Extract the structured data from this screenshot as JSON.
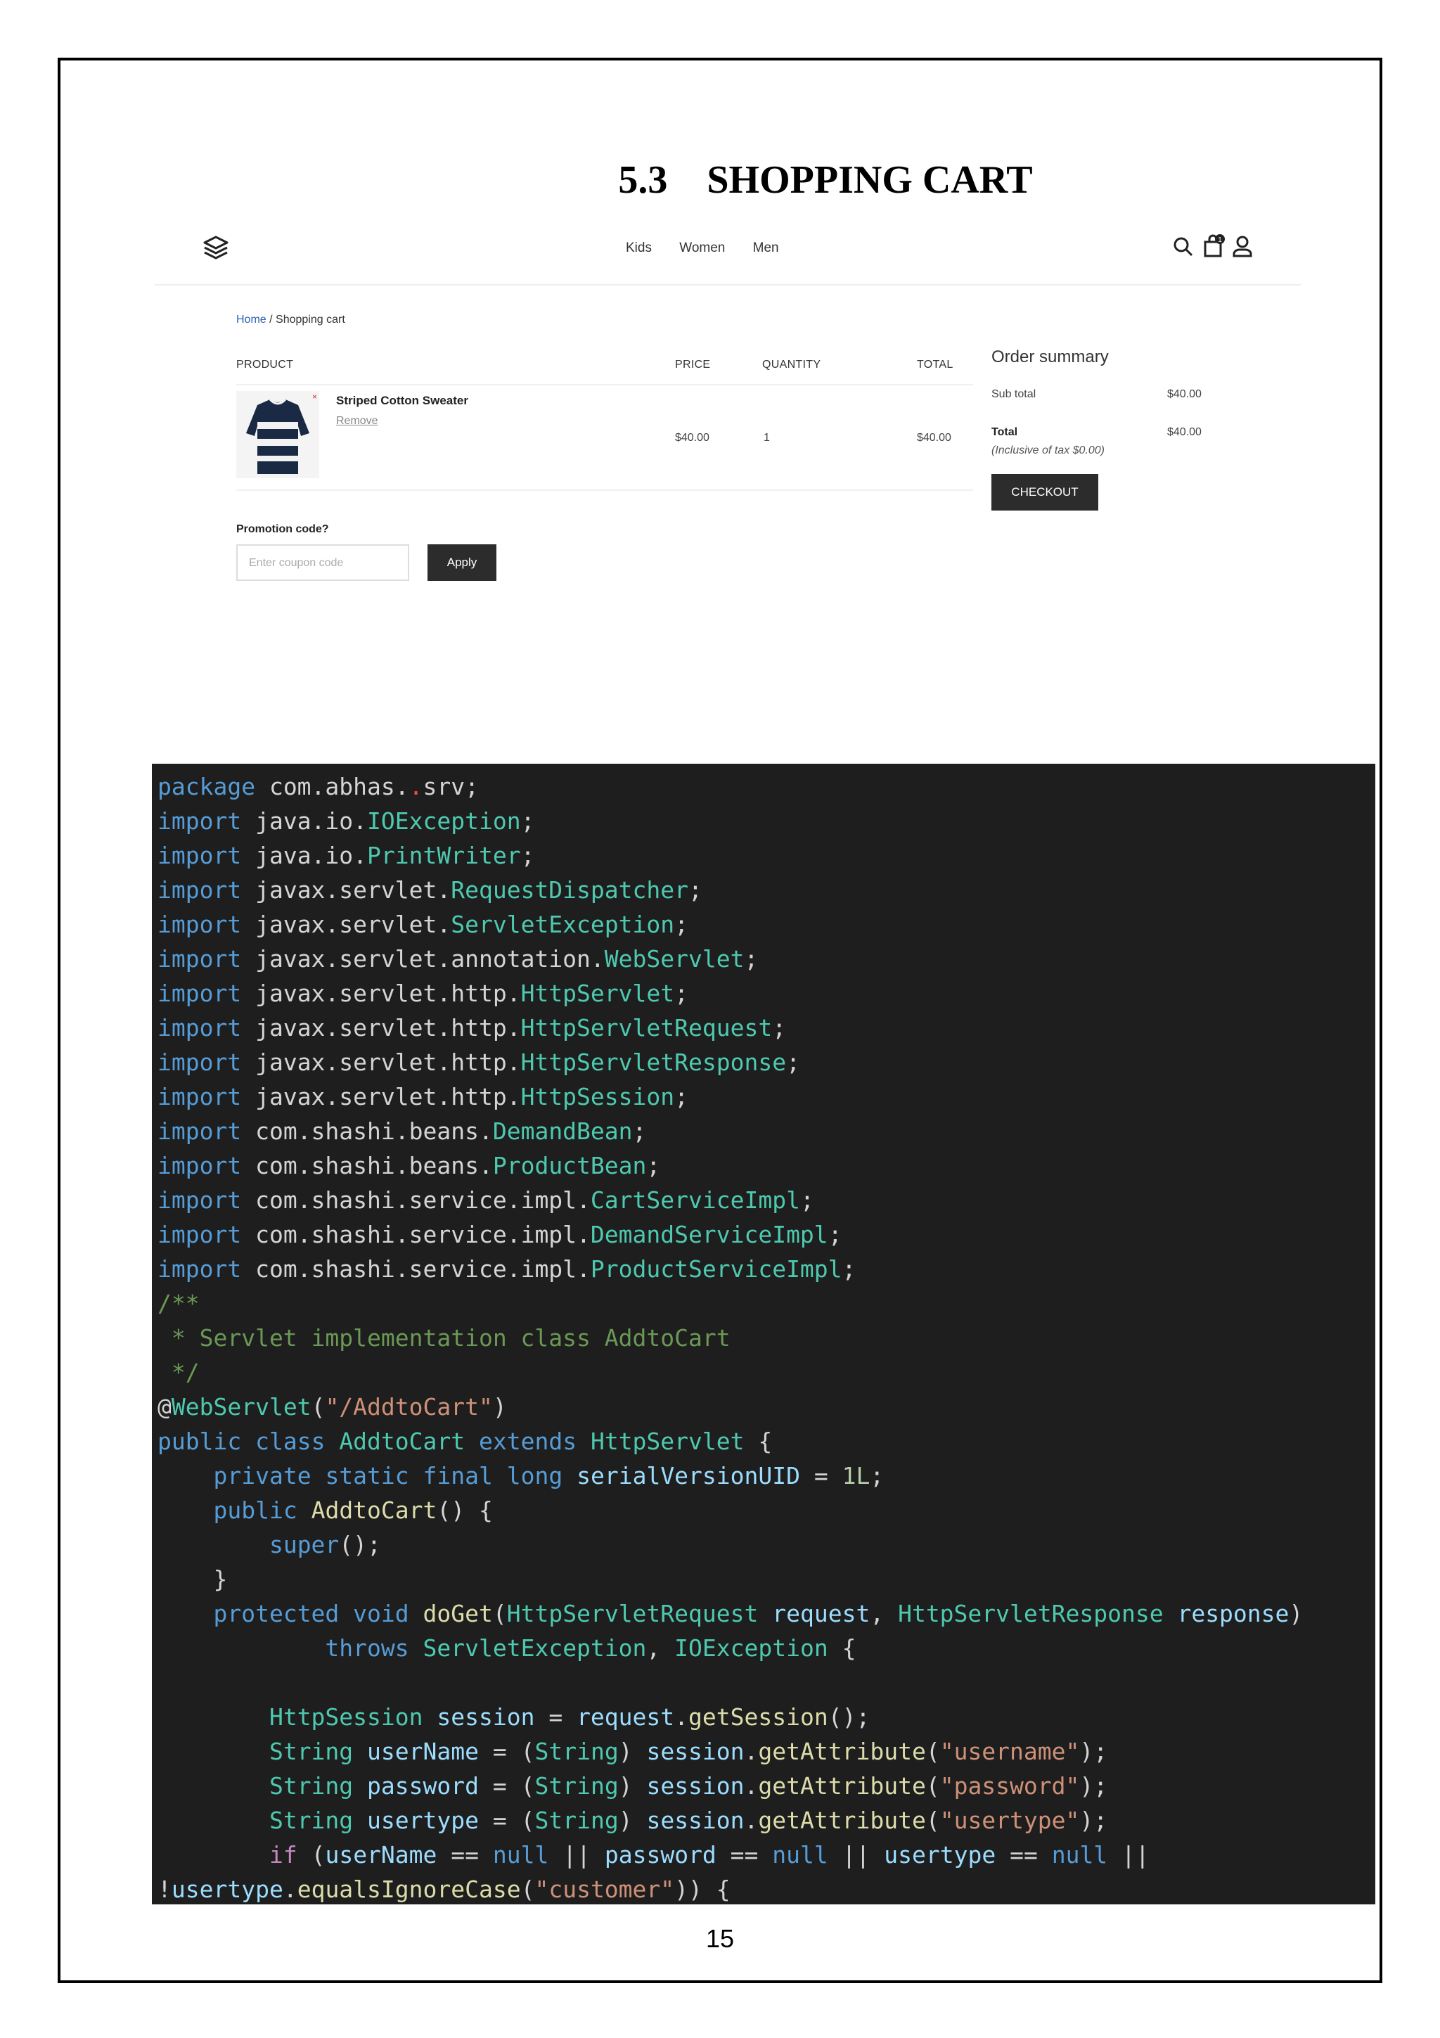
{
  "document": {
    "section_number": "5.3",
    "section_title": "SHOPPING CART",
    "page_number": "15"
  },
  "screenshot": {
    "nav": {
      "links": [
        "Kids",
        "Women",
        "Men"
      ],
      "cart_count": "1"
    },
    "breadcrumb": {
      "home": "Home",
      "separator": "/",
      "current": "Shopping cart"
    },
    "table_headers": {
      "product": "PRODUCT",
      "price": "PRICE",
      "quantity": "QUANTITY",
      "total": "TOTAL"
    },
    "item": {
      "name": "Striped Cotton Sweater",
      "remove": "Remove",
      "price": "$40.00",
      "quantity": "1",
      "total": "$40.00"
    },
    "promo": {
      "label": "Promotion code?",
      "placeholder": "Enter coupon code",
      "apply": "Apply"
    },
    "summary": {
      "title": "Order summary",
      "subtotal_label": "Sub total",
      "subtotal_value": "$40.00",
      "total_label": "Total",
      "total_value": "$40.00",
      "tax_note": "(Inclusive of tax $0.00)",
      "checkout": "CHECKOUT"
    }
  },
  "code_lines": [
    [
      [
        "kw",
        "package"
      ],
      [
        "p",
        " com.abhas."
      ],
      [
        "err",
        "."
      ],
      [
        "p",
        "srv;"
      ]
    ],
    [
      [
        "kw",
        "import"
      ],
      [
        "p",
        " java.io."
      ],
      [
        "ty",
        "IOException"
      ],
      [
        "p",
        ";"
      ]
    ],
    [
      [
        "kw",
        "import"
      ],
      [
        "p",
        " java.io."
      ],
      [
        "ty",
        "PrintWriter"
      ],
      [
        "p",
        ";"
      ]
    ],
    [
      [
        "kw",
        "import"
      ],
      [
        "p",
        " javax.servlet."
      ],
      [
        "ty",
        "RequestDispatcher"
      ],
      [
        "p",
        ";"
      ]
    ],
    [
      [
        "kw",
        "import"
      ],
      [
        "p",
        " javax.servlet."
      ],
      [
        "ty",
        "ServletException"
      ],
      [
        "p",
        ";"
      ]
    ],
    [
      [
        "kw",
        "import"
      ],
      [
        "p",
        " javax.servlet.annotation."
      ],
      [
        "ty",
        "WebServlet"
      ],
      [
        "p",
        ";"
      ]
    ],
    [
      [
        "kw",
        "import"
      ],
      [
        "p",
        " javax.servlet.http."
      ],
      [
        "ty",
        "HttpServlet"
      ],
      [
        "p",
        ";"
      ]
    ],
    [
      [
        "kw",
        "import"
      ],
      [
        "p",
        " javax.servlet.http."
      ],
      [
        "ty",
        "HttpServletRequest"
      ],
      [
        "p",
        ";"
      ]
    ],
    [
      [
        "kw",
        "import"
      ],
      [
        "p",
        " javax.servlet.http."
      ],
      [
        "ty",
        "HttpServletResponse"
      ],
      [
        "p",
        ";"
      ]
    ],
    [
      [
        "kw",
        "import"
      ],
      [
        "p",
        " javax.servlet.http."
      ],
      [
        "ty",
        "HttpSession"
      ],
      [
        "p",
        ";"
      ]
    ],
    [
      [
        "kw",
        "import"
      ],
      [
        "p",
        " com.shashi.beans."
      ],
      [
        "ty",
        "DemandBean"
      ],
      [
        "p",
        ";"
      ]
    ],
    [
      [
        "kw",
        "import"
      ],
      [
        "p",
        " com.shashi.beans."
      ],
      [
        "ty",
        "ProductBean"
      ],
      [
        "p",
        ";"
      ]
    ],
    [
      [
        "kw",
        "import"
      ],
      [
        "p",
        " com.shashi.service.impl."
      ],
      [
        "ty",
        "CartServiceImpl"
      ],
      [
        "p",
        ";"
      ]
    ],
    [
      [
        "kw",
        "import"
      ],
      [
        "p",
        " com.shashi.service.impl."
      ],
      [
        "ty",
        "DemandServiceImpl"
      ],
      [
        "p",
        ";"
      ]
    ],
    [
      [
        "kw",
        "import"
      ],
      [
        "p",
        " com.shashi.service.impl."
      ],
      [
        "ty",
        "ProductServiceImpl"
      ],
      [
        "p",
        ";"
      ]
    ],
    [
      [
        "cm",
        "/**"
      ]
    ],
    [
      [
        "cm",
        " * Servlet implementation class AddtoCart"
      ]
    ],
    [
      [
        "cm",
        " */"
      ]
    ],
    [
      [
        "p",
        "@"
      ],
      [
        "ty",
        "WebServlet"
      ],
      [
        "p",
        "("
      ],
      [
        "st",
        "\"/AddtoCart\""
      ],
      [
        "p",
        ")"
      ]
    ],
    [
      [
        "kw",
        "public"
      ],
      [
        "p",
        " "
      ],
      [
        "kw",
        "class"
      ],
      [
        "p",
        " "
      ],
      [
        "ty",
        "AddtoCart"
      ],
      [
        "p",
        " "
      ],
      [
        "kw",
        "extends"
      ],
      [
        "p",
        " "
      ],
      [
        "ty",
        "HttpServlet"
      ],
      [
        "p",
        " {"
      ]
    ],
    [
      [
        "p",
        "    "
      ],
      [
        "kw",
        "private"
      ],
      [
        "p",
        " "
      ],
      [
        "kw",
        "static"
      ],
      [
        "p",
        " "
      ],
      [
        "kw",
        "final"
      ],
      [
        "p",
        " "
      ],
      [
        "kw",
        "long"
      ],
      [
        "p",
        " "
      ],
      [
        "vr",
        "serialVersionUID"
      ],
      [
        "p",
        " = "
      ],
      [
        "nm",
        "1L"
      ],
      [
        "p",
        ";"
      ]
    ],
    [
      [
        "p",
        "    "
      ],
      [
        "kw",
        "public"
      ],
      [
        "p",
        " "
      ],
      [
        "fn",
        "AddtoCart"
      ],
      [
        "p",
        "() {"
      ]
    ],
    [
      [
        "p",
        "        "
      ],
      [
        "kw",
        "super"
      ],
      [
        "p",
        "();"
      ]
    ],
    [
      [
        "p",
        "    }"
      ]
    ],
    [
      [
        "p",
        "    "
      ],
      [
        "kw",
        "protected"
      ],
      [
        "p",
        " "
      ],
      [
        "kw",
        "void"
      ],
      [
        "p",
        " "
      ],
      [
        "fn",
        "doGet"
      ],
      [
        "p",
        "("
      ],
      [
        "ty",
        "HttpServletRequest"
      ],
      [
        "p",
        " "
      ],
      [
        "vr",
        "request"
      ],
      [
        "p",
        ", "
      ],
      [
        "ty",
        "HttpServletResponse"
      ],
      [
        "p",
        " "
      ],
      [
        "vr",
        "response"
      ],
      [
        "p",
        ")"
      ]
    ],
    [
      [
        "p",
        "            "
      ],
      [
        "kw",
        "throws"
      ],
      [
        "p",
        " "
      ],
      [
        "ty",
        "ServletException"
      ],
      [
        "p",
        ", "
      ],
      [
        "ty",
        "IOException"
      ],
      [
        "p",
        " {"
      ]
    ],
    [
      [
        "p",
        ""
      ]
    ],
    [
      [
        "p",
        "        "
      ],
      [
        "ty",
        "HttpSession"
      ],
      [
        "p",
        " "
      ],
      [
        "vr",
        "session"
      ],
      [
        "p",
        " = "
      ],
      [
        "vr",
        "request"
      ],
      [
        "p",
        "."
      ],
      [
        "fn",
        "getSession"
      ],
      [
        "p",
        "();"
      ]
    ],
    [
      [
        "p",
        "        "
      ],
      [
        "ty",
        "String"
      ],
      [
        "p",
        " "
      ],
      [
        "vr",
        "userName"
      ],
      [
        "p",
        " = ("
      ],
      [
        "ty",
        "String"
      ],
      [
        "p",
        ") "
      ],
      [
        "vr",
        "session"
      ],
      [
        "p",
        "."
      ],
      [
        "fn",
        "getAttribute"
      ],
      [
        "p",
        "("
      ],
      [
        "st",
        "\"username\""
      ],
      [
        "p",
        ");"
      ]
    ],
    [
      [
        "p",
        "        "
      ],
      [
        "ty",
        "String"
      ],
      [
        "p",
        " "
      ],
      [
        "vr",
        "password"
      ],
      [
        "p",
        " = ("
      ],
      [
        "ty",
        "String"
      ],
      [
        "p",
        ") "
      ],
      [
        "vr",
        "session"
      ],
      [
        "p",
        "."
      ],
      [
        "fn",
        "getAttribute"
      ],
      [
        "p",
        "("
      ],
      [
        "st",
        "\"password\""
      ],
      [
        "p",
        ");"
      ]
    ],
    [
      [
        "p",
        "        "
      ],
      [
        "ty",
        "String"
      ],
      [
        "p",
        " "
      ],
      [
        "vr",
        "usertype"
      ],
      [
        "p",
        " = ("
      ],
      [
        "ty",
        "String"
      ],
      [
        "p",
        ") "
      ],
      [
        "vr",
        "session"
      ],
      [
        "p",
        "."
      ],
      [
        "fn",
        "getAttribute"
      ],
      [
        "p",
        "("
      ],
      [
        "st",
        "\"usertype\""
      ],
      [
        "p",
        ");"
      ]
    ],
    [
      [
        "p",
        "        "
      ],
      [
        "ctl",
        "if"
      ],
      [
        "p",
        " ("
      ],
      [
        "vr",
        "userName"
      ],
      [
        "p",
        " == "
      ],
      [
        "kw",
        "null"
      ],
      [
        "p",
        " || "
      ],
      [
        "vr",
        "password"
      ],
      [
        "p",
        " == "
      ],
      [
        "kw",
        "null"
      ],
      [
        "p",
        " || "
      ],
      [
        "vr",
        "usertype"
      ],
      [
        "p",
        " == "
      ],
      [
        "kw",
        "null"
      ],
      [
        "p",
        " ||"
      ]
    ],
    [
      [
        "p",
        "!"
      ],
      [
        "vr",
        "usertype"
      ],
      [
        "p",
        "."
      ],
      [
        "fn",
        "equalsIgnoreCase"
      ],
      [
        "p",
        "("
      ],
      [
        "st",
        "\"customer\""
      ],
      [
        "p",
        ")) {"
      ]
    ]
  ]
}
